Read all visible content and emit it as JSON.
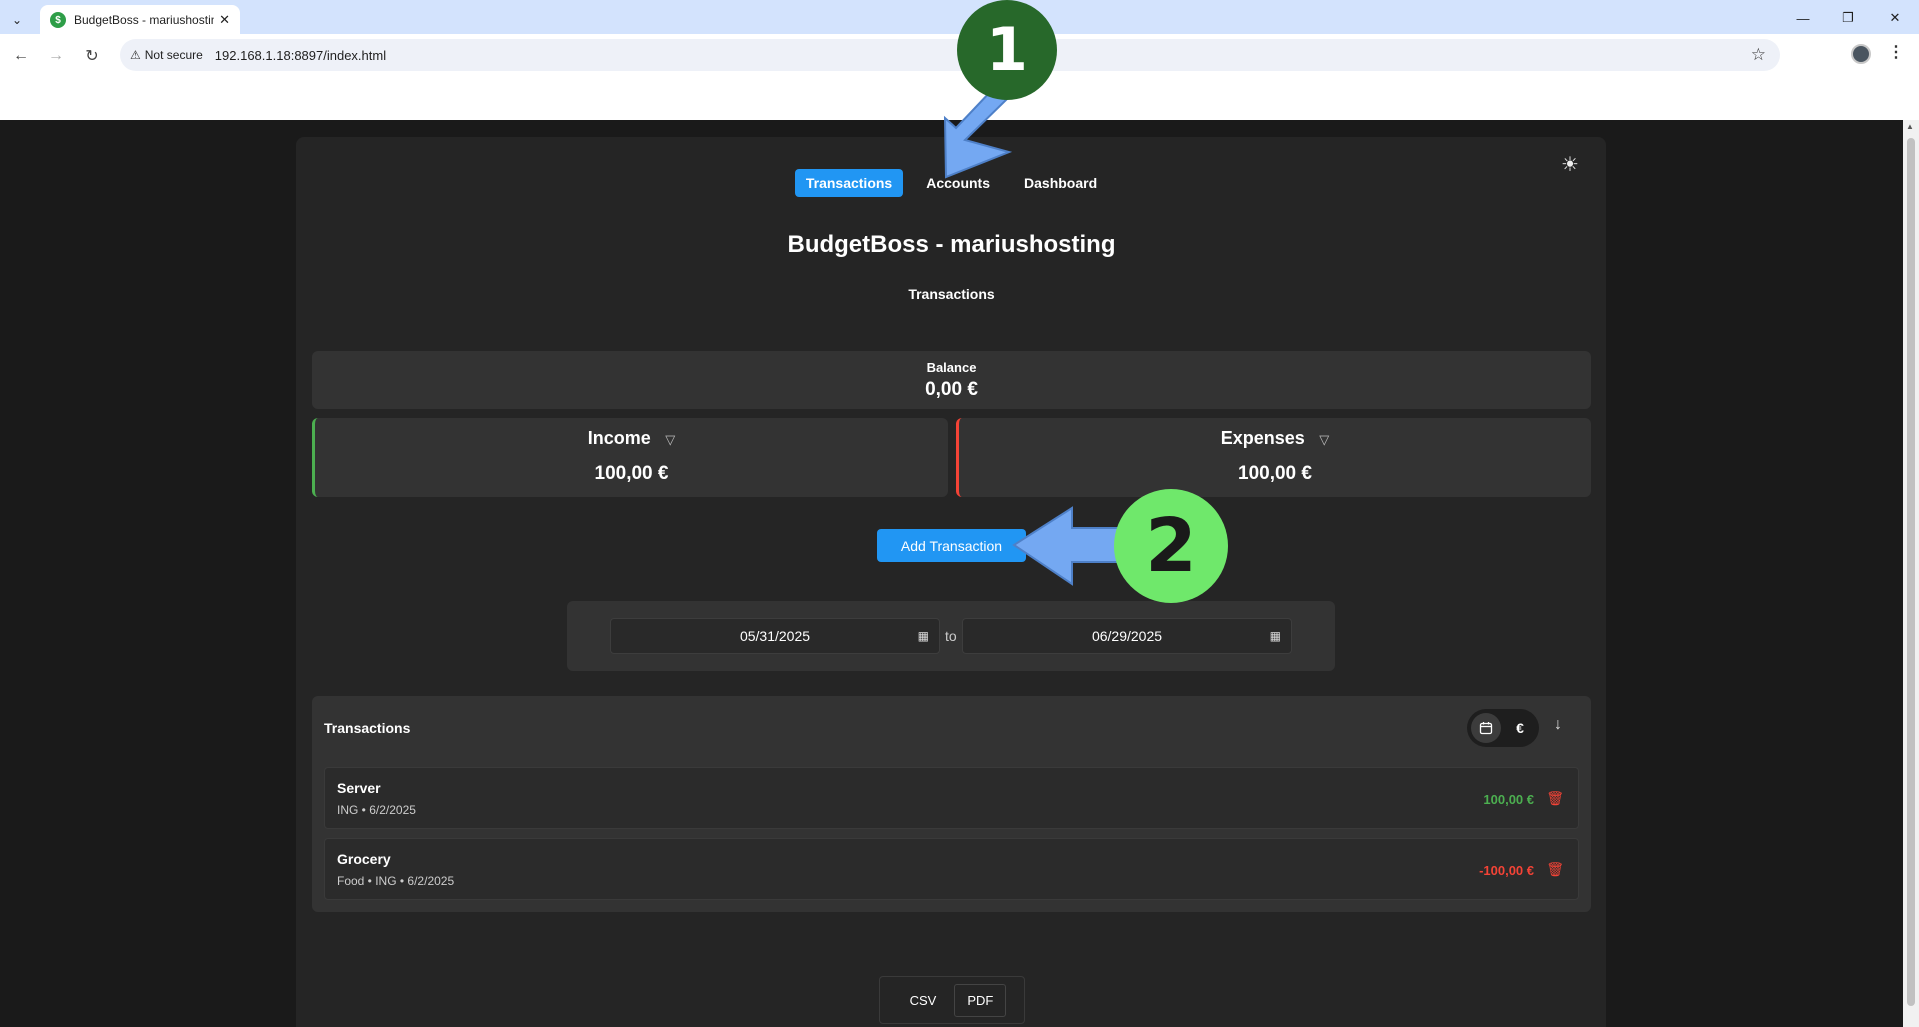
{
  "browser": {
    "tab_title": "BudgetBoss - mariushosting",
    "security_label": "Not secure",
    "url": "192.168.1.18:8897/index.html"
  },
  "nav": {
    "tabs": [
      "Transactions",
      "Accounts",
      "Dashboard"
    ],
    "active": "Transactions"
  },
  "app": {
    "title": "BudgetBoss - mariushosting",
    "section": "Transactions"
  },
  "balance": {
    "label": "Balance",
    "value": "0,00 €"
  },
  "income": {
    "label": "Income",
    "value": "100,00 €",
    "accent": "#4caf50"
  },
  "expenses": {
    "label": "Expenses",
    "value": "100,00 €",
    "accent": "#f44336"
  },
  "actions": {
    "add_transaction": "Add Transaction"
  },
  "date_range": {
    "from": "05/31/2025",
    "separator": "to",
    "to": "06/29/2025"
  },
  "transactions": {
    "heading": "Transactions",
    "currency_symbol": "€",
    "rows": [
      {
        "name": "Server",
        "meta": "ING  •  6/2/2025",
        "amount": "100,00 €",
        "type": "income"
      },
      {
        "name": "Grocery",
        "meta": "Food  •  ING  •  6/2/2025",
        "amount": "-100,00 €",
        "type": "expense"
      }
    ]
  },
  "export": {
    "csv": "CSV",
    "pdf": "PDF"
  },
  "annotations": {
    "step1": "1",
    "step2": "2"
  },
  "icons": {
    "theme": "sun-icon",
    "filter": "filter-icon",
    "calendar": "calendar-icon",
    "sort": "arrow-down-icon",
    "delete": "trash-icon"
  }
}
